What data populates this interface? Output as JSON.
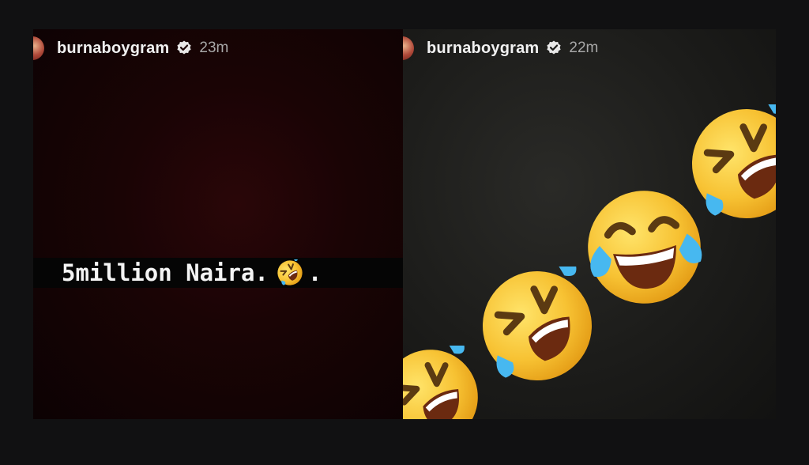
{
  "stories": [
    {
      "username": "burnaboygram",
      "verified_icon": "verified-badge-icon",
      "timestamp": "23m",
      "caption": "5million Naira.",
      "caption_emoji": "rolling-on-floor-laughing-emoji",
      "caption_suffix": ".",
      "background_color": "#1a0405"
    },
    {
      "username": "burnaboygram",
      "verified_icon": "verified-badge-icon",
      "timestamp": "22m",
      "stickers": [
        "rolling-on-floor-laughing-emoji",
        "face-with-tears-of-joy-emoji",
        "rolling-on-floor-laughing-emoji",
        "rolling-on-floor-laughing-emoji"
      ],
      "background_color": "#1c1c1a"
    }
  ],
  "colors": {
    "page_background": "#111112",
    "emoji_yellow": "#f7c233",
    "tear_blue": "#47b8f0"
  }
}
